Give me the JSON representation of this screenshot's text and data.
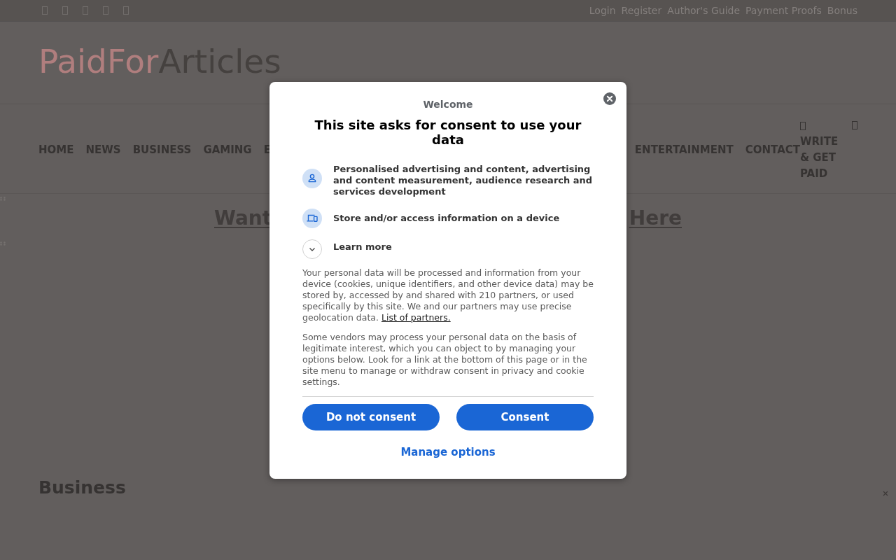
{
  "top_bar": {
    "links": [
      "Login",
      "Register",
      "Author's Guide",
      "Payment Proofs",
      "Bonus"
    ]
  },
  "header": {
    "logo": {
      "lead": "PaidFor",
      "rest": "Articles"
    }
  },
  "nav": {
    "items": [
      "HOME",
      "NEWS",
      "BUSINESS",
      "GAMING",
      "E"
    ],
    "right_items": [
      "ENTERTAINMENT",
      "CONTACT"
    ],
    "write_link": "WRITE & GET PAID"
  },
  "banner_link": {
    "start": "Want",
    "end": "Here"
  },
  "section_title": "Business",
  "consent_dialog": {
    "eyebrow": "Welcome",
    "title": "This site asks for consent to use your data",
    "purposes": [
      "Personalised advertising and content, advertising and content measurement, audience research and services development",
      "Store and/or access information on a device"
    ],
    "learn_more": "Learn more",
    "paragraphs": [
      {
        "text": "Your personal data will be processed and information from your device (cookies, unique identifiers, and other device data) may be stored by, accessed by and shared with 210 partners, or used specifically by this site. We and our partners may use precise geolocation data.",
        "link": "List of partners."
      },
      {
        "text": "Some vendors may process your personal data on the basis of legitimate interest, which you can object to by managing your options below. Look for a link at the bottom of this page or in the site menu to manage or withdraw consent in privacy and cookie settings."
      }
    ],
    "buttons": [
      "Do not consent",
      "Consent"
    ],
    "manage_link": "Manage options"
  }
}
